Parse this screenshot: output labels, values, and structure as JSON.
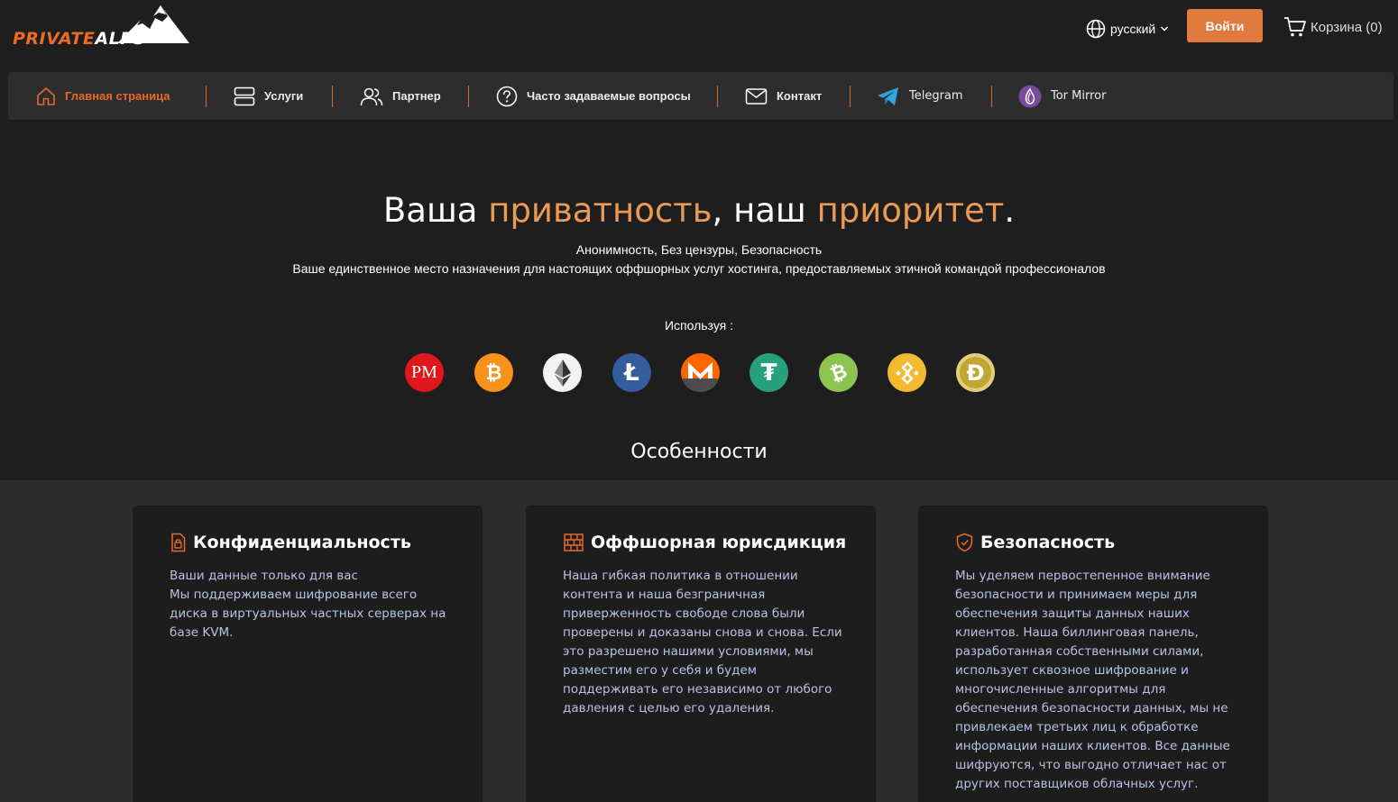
{
  "header": {
    "logo": {
      "part1": "PRIVATE",
      "part2": "ALPS"
    },
    "language": "русский",
    "login_label": "Войти",
    "cart_label": "Корзина (0)"
  },
  "nav": [
    {
      "label": "Главная страница",
      "icon": "home-icon",
      "active": true
    },
    {
      "label": "Услуги",
      "icon": "server-icon"
    },
    {
      "label": "Партнер",
      "icon": "users-icon"
    },
    {
      "label": "Часто задаваемые вопросы",
      "icon": "question-circle-icon"
    },
    {
      "label": "Контакт",
      "icon": "envelope-icon"
    },
    {
      "label": "Telegram",
      "icon": "telegram-icon"
    },
    {
      "label": "Tor Mirror",
      "icon": "tor-icon"
    }
  ],
  "hero": {
    "title_part1": "Ваша ",
    "title_hl1": "приватность",
    "title_part2": ", наш ",
    "title_hl2": "приоритет",
    "title_part3": ".",
    "tagline": "Анонимность, Без цензуры, Безопасность",
    "description": "Ваше единственное место назначения для настоящих оффшорных услуг хостинга, предоставляемых этичной командой профессионалов",
    "using_label": "Используя :"
  },
  "payment_methods": [
    {
      "icon": "perfect-money-icon",
      "glyph": "PM",
      "color": "#e0171d"
    },
    {
      "icon": "bitcoin-icon",
      "glyph": "₿",
      "color": "#f7931a"
    },
    {
      "icon": "ethereum-icon",
      "glyph": "",
      "color": "#f2f2f2"
    },
    {
      "icon": "litecoin-icon",
      "glyph": "Ł",
      "color": "#345d9d"
    },
    {
      "icon": "monero-icon",
      "glyph": "",
      "color": "#ff6600"
    },
    {
      "icon": "tether-icon",
      "glyph": "₮",
      "color": "#26a17b"
    },
    {
      "icon": "bitcoin-cash-icon",
      "glyph": "₿",
      "color": "#8dc351"
    },
    {
      "icon": "binance-coin-icon",
      "glyph": "",
      "color": "#f3ba2f"
    },
    {
      "icon": "dogecoin-icon",
      "glyph": "Ð",
      "color": "#c2a633"
    }
  ],
  "features": {
    "title": "Особенности",
    "cards": [
      {
        "title": "Конфиденциальность",
        "icon": "lock-file-icon",
        "lines": [
          "Ваши данные только для вас",
          "Мы поддерживаем шифрование всего диска в виртуальных частных серверах на базе KVM."
        ]
      },
      {
        "title": "Оффшорная юрисдикция",
        "icon": "brick-wall-icon",
        "lines": [
          "Наша гибкая политика в отношении контента и наша безграничная приверженность свободе слова были проверены и доказаны снова и снова. Если это разрешено нашими условиями, мы разместим его у себя и будем поддерживать его независимо от любого давления с целью его удаления."
        ]
      },
      {
        "title": "Безопасность",
        "icon": "shield-check-icon",
        "lines": [
          "Мы уделяем первостепенное внимание безопасности и принимаем меры для обеспечения защиты данных наших клиентов. Наша биллинговая панель, разработанная собственными силами, использует сквозное шифрование и многочисленные алгоритмы для обеспечения безопасности данных, мы не привлекаем третьих лиц к обработке информации наших клиентов. Все данные шифруются, что выгодно отличает нас от других поставщиков облачных услуг."
        ]
      }
    ]
  },
  "colors": {
    "accent": "#e07a3f",
    "highlight": "#eb9a53",
    "background": "#1e1e1e",
    "nav_bg": "#2d2d2d",
    "card_text": "#b8c2e6"
  }
}
